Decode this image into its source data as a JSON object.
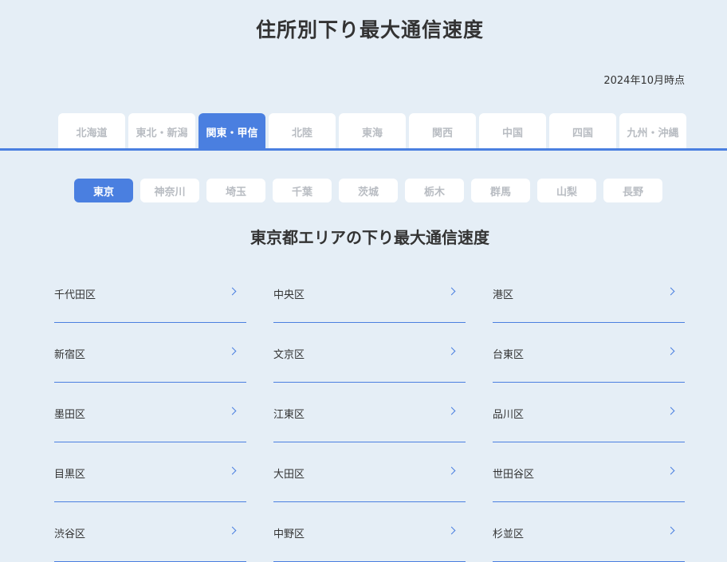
{
  "page": {
    "title": "住所別下り最大通信速度",
    "as_of": "2024年10月時点"
  },
  "region_tabs": [
    {
      "label": "北海道",
      "active": false
    },
    {
      "label": "東北・新潟",
      "active": false
    },
    {
      "label": "関東・甲信",
      "active": true
    },
    {
      "label": "北陸",
      "active": false
    },
    {
      "label": "東海",
      "active": false
    },
    {
      "label": "関西",
      "active": false
    },
    {
      "label": "中国",
      "active": false
    },
    {
      "label": "四国",
      "active": false
    },
    {
      "label": "九州・沖縄",
      "active": false
    }
  ],
  "prefecture_tabs": [
    {
      "label": "東京",
      "active": true
    },
    {
      "label": "神奈川",
      "active": false
    },
    {
      "label": "埼玉",
      "active": false
    },
    {
      "label": "千葉",
      "active": false
    },
    {
      "label": "茨城",
      "active": false
    },
    {
      "label": "栃木",
      "active": false
    },
    {
      "label": "群馬",
      "active": false
    },
    {
      "label": "山梨",
      "active": false
    },
    {
      "label": "長野",
      "active": false
    }
  ],
  "section": {
    "title": "東京都エリアの下り最大通信速度"
  },
  "wards": [
    "千代田区",
    "中央区",
    "港区",
    "新宿区",
    "文京区",
    "台東区",
    "墨田区",
    "江東区",
    "品川区",
    "目黒区",
    "大田区",
    "世田谷区",
    "渋谷区",
    "中野区",
    "杉並区"
  ],
  "colors": {
    "accent": "#4a7fe0",
    "background": "#e5eef6",
    "inactive_text": "#b8bcc2"
  },
  "icons": {
    "ward_link": "chevron-right-icon"
  }
}
